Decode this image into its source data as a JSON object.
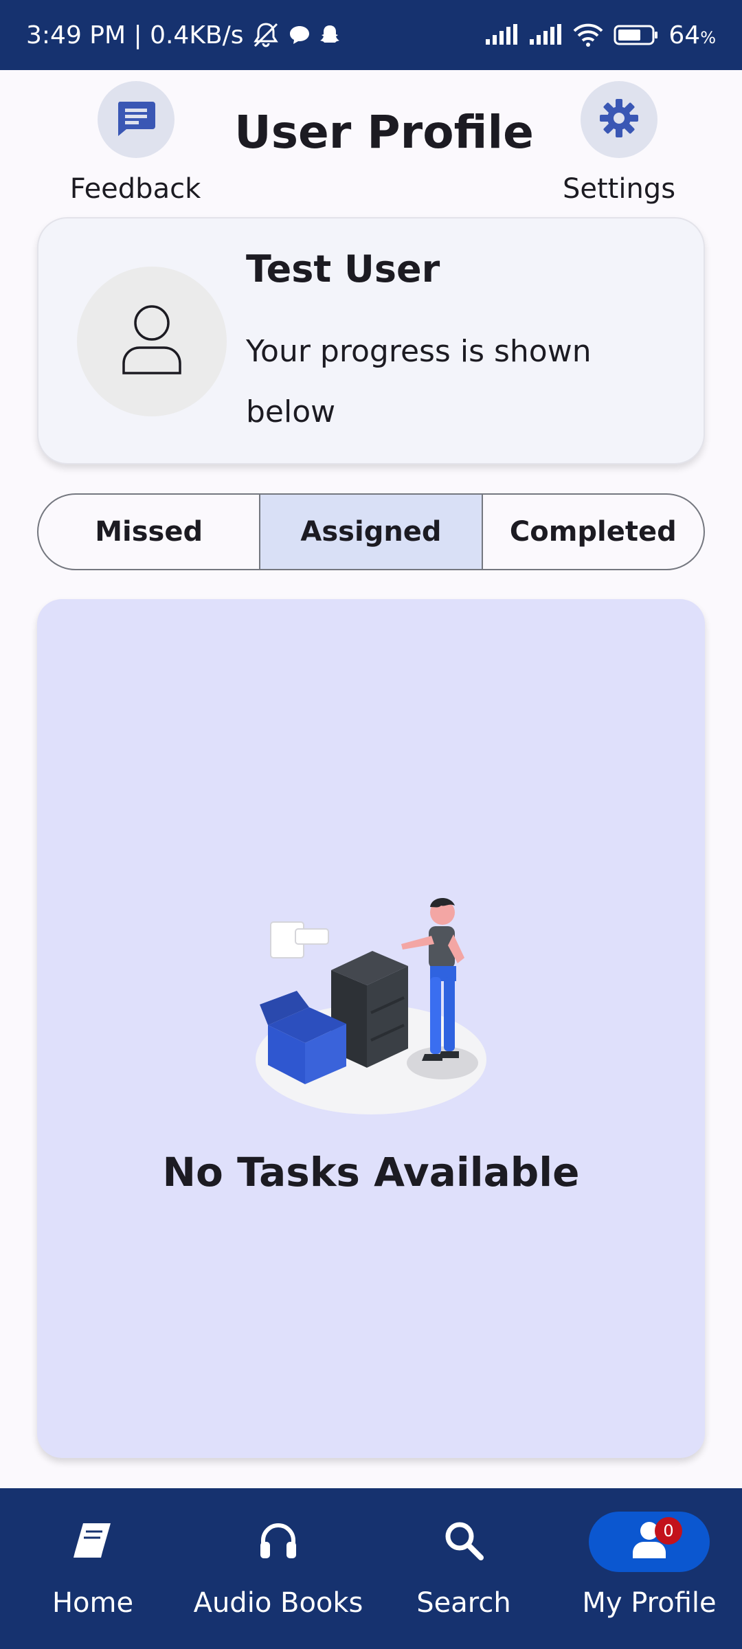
{
  "status_bar": {
    "time_speed": "3:49 PM | 0.4KB/s",
    "battery": "64",
    "battery_unit": "%",
    "icons": [
      "mute-bell-icon",
      "chat-bubble-icon",
      "snapchat-icon",
      "signal-icon",
      "signal-icon",
      "wifi-icon",
      "battery-icon"
    ]
  },
  "header": {
    "title": "User Profile",
    "feedback_label": "Feedback",
    "settings_label": "Settings"
  },
  "profile": {
    "name": "Test User",
    "subtitle": "Your progress is shown below"
  },
  "tabs": [
    {
      "label": "Missed",
      "selected": false
    },
    {
      "label": "Assigned",
      "selected": true
    },
    {
      "label": "Completed",
      "selected": false
    }
  ],
  "tasks": {
    "empty_message": "No Tasks Available"
  },
  "bottom_nav": [
    {
      "label": "Home",
      "icon": "book-icon",
      "active": false
    },
    {
      "label": "Audio Books",
      "icon": "headphones-icon",
      "active": false
    },
    {
      "label": "Search",
      "icon": "search-icon",
      "active": false
    },
    {
      "label": "My Profile",
      "icon": "user-icon",
      "active": true,
      "badge": "0"
    }
  ],
  "colors": {
    "primary_dark": "#16326f",
    "active_pill": "#0b57d0",
    "task_card_bg": "#dfe0fb",
    "selected_tab_bg": "#d9e0f6",
    "badge_red": "#c3121b"
  }
}
